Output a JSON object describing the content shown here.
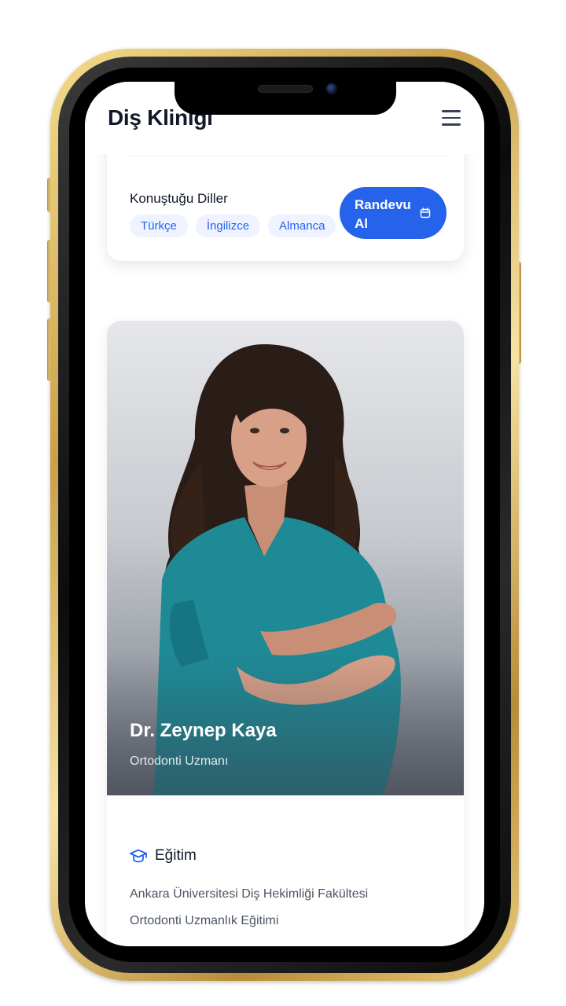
{
  "header": {
    "brand": "Diş Kliniği",
    "menu_icon": "hamburger-menu-icon"
  },
  "languages": {
    "label": "Konuştuğu Diller",
    "items": [
      "Türkçe",
      "İngilizce",
      "Almanca"
    ]
  },
  "cta": {
    "label": "Randevu Al",
    "icon": "calendar-icon"
  },
  "doctor": {
    "name": "Dr. Zeynep Kaya",
    "title": "Ortodonti Uzmanı",
    "education": {
      "heading": "Eğitim",
      "icon": "graduation-cap-icon",
      "lines": [
        "Ankara Üniversitesi Diş Hekimliği Fakültesi",
        "Ortodonti Uzmanlık Eğitimi"
      ]
    }
  },
  "colors": {
    "accent": "#2563eb",
    "chip_bg": "#eef3ff",
    "scrub": "#1e8a96",
    "frame_gold": "#d4ad55"
  }
}
